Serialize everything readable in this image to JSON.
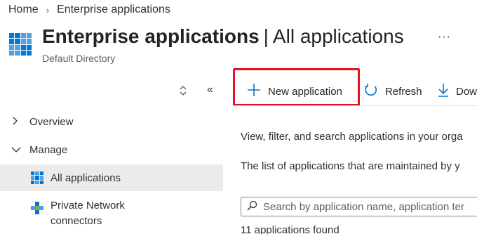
{
  "breadcrumb": {
    "home": "Home",
    "current": "Enterprise applications"
  },
  "header": {
    "title": "Enterprise applications",
    "divider": "|",
    "subtitle_page": "All applications",
    "directory": "Default Directory",
    "more": "···"
  },
  "toolbar": {
    "new_application": "New application",
    "refresh": "Refresh",
    "download": "Dow"
  },
  "sidebar": {
    "overview": "Overview",
    "manage": "Manage",
    "all_applications": "All applications",
    "private_network_line1": "Private Network",
    "private_network_line2": "connectors"
  },
  "main": {
    "description1": "View, filter, and search applications in your orga",
    "description2": "The list of applications that are maintained by y",
    "search_placeholder": "Search by application name, application ter",
    "results_count": "11 applications found"
  },
  "colors": {
    "accent": "#0078d4",
    "highlight": "#e81123",
    "selected_bg": "#edebe9"
  }
}
